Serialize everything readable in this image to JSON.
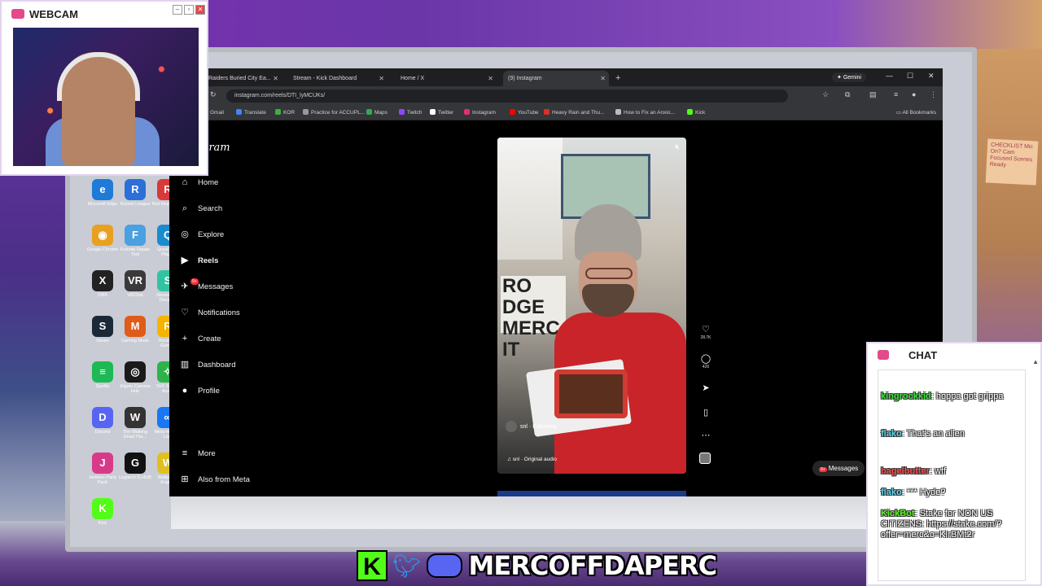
{
  "overlay": {
    "webcam_title": "WEBCAM",
    "chat_title": "CHAT",
    "checklist_note": "CHECKLIST Mic On? Cam Focused Scenes Ready",
    "handle": "MERCOFFDAPERC",
    "kick_letter": "K"
  },
  "browser": {
    "tabs": [
      {
        "label": "Raiders Buried City Ea..."
      },
      {
        "label": "Stream - Kick Dashboard"
      },
      {
        "label": "Home / X"
      },
      {
        "label": "(9) Instagram"
      }
    ],
    "gemini_label": "Gemini",
    "url": "instagram.com/reels/DTI_lyMCUKs/",
    "bookmarks": [
      {
        "label": "Gmail",
        "color": "#d93025"
      },
      {
        "label": "Translate",
        "color": "#4285f4"
      },
      {
        "label": "KOR",
        "color": "#3cb043"
      },
      {
        "label": "Practice for ACCUPL...",
        "color": "#999999"
      },
      {
        "label": "Maps",
        "color": "#34a853"
      },
      {
        "label": "Twitch",
        "color": "#9146ff"
      },
      {
        "label": "Twitter",
        "color": "#ffffff"
      },
      {
        "label": "Instagram",
        "color": "#e1306c"
      },
      {
        "label": "YouTube",
        "color": "#ff0000"
      },
      {
        "label": "Heavy Rain and Thu...",
        "color": "#d93025"
      },
      {
        "label": "How to Fix an Anxio...",
        "color": "#bbbbbb"
      },
      {
        "label": "Kick",
        "color": "#53fc18"
      }
    ],
    "all_bookmarks": "All Bookmarks"
  },
  "instagram": {
    "logo": "gram",
    "nav": [
      {
        "label": "Home",
        "icon": "home-icon",
        "glyph": "⌂"
      },
      {
        "label": "Search",
        "icon": "search-icon",
        "glyph": "⌕"
      },
      {
        "label": "Explore",
        "icon": "compass-icon",
        "glyph": "◎"
      },
      {
        "label": "Reels",
        "icon": "reels-icon",
        "glyph": "▶"
      },
      {
        "label": "Messages",
        "icon": "messages-icon",
        "glyph": "✈",
        "badge": "9+"
      },
      {
        "label": "Notifications",
        "icon": "heart-icon",
        "glyph": "♡"
      },
      {
        "label": "Create",
        "icon": "plus-icon",
        "glyph": "+"
      },
      {
        "label": "Dashboard",
        "icon": "dashboard-icon",
        "glyph": "▥"
      },
      {
        "label": "Profile",
        "icon": "avatar-icon",
        "glyph": "●"
      }
    ],
    "more": "More",
    "also_from_meta": "Also from Meta",
    "reel": {
      "username": "snl",
      "following": "Following",
      "audio": "snl · Original audio",
      "sign_text": "RO\nDGE\nMERC\nIT",
      "likes": "28.7K",
      "comments": "426"
    },
    "messages_pill": "Messages",
    "messages_badge": "9+"
  },
  "desktop_icons": [
    {
      "label": "Microsoft Edge",
      "color": "#1f7ad8",
      "glyph": "e"
    },
    {
      "label": "Rocket League",
      "color": "#2c6fd8",
      "glyph": "R"
    },
    {
      "label": "Riot Repair Tool",
      "color": "#d83a3a",
      "glyph": "R"
    },
    {
      "label": "Google Chrome",
      "color": "#e8a020",
      "glyph": "◉"
    },
    {
      "label": "Fortnite Repair Tool",
      "color": "#4aa0e0",
      "glyph": "F"
    },
    {
      "label": "QuickTime Player",
      "color": "#1b8bd0",
      "glyph": "Q"
    },
    {
      "label": "OBS",
      "color": "#222222",
      "glyph": "X"
    },
    {
      "label": "VRChat",
      "color": "#3a3a3a",
      "glyph": "VR"
    },
    {
      "label": "Streamlabs Desktop",
      "color": "#31c3a2",
      "glyph": "S"
    },
    {
      "label": "Steam",
      "color": "#1b2838",
      "glyph": "S"
    },
    {
      "label": "Gaming Mode",
      "color": "#e05a1a",
      "glyph": "M"
    },
    {
      "label": "Rockstar Games",
      "color": "#f4b400",
      "glyph": "R"
    },
    {
      "label": "Spotify",
      "color": "#1db954",
      "glyph": "≡"
    },
    {
      "label": "Elgato Camera Hub",
      "color": "#1a1a1a",
      "glyph": "◎"
    },
    {
      "label": "THX Spatial Audio",
      "color": "#2db34a",
      "glyph": "✧"
    },
    {
      "label": "Discord",
      "color": "#5865f2",
      "glyph": "D"
    },
    {
      "label": "The Walking Dead The...",
      "color": "#333333",
      "glyph": "W"
    },
    {
      "label": "Meta Horizon Link",
      "color": "#1877f2",
      "glyph": "∞"
    },
    {
      "label": "Jackbox Party Pack",
      "color": "#d83a8a",
      "glyph": "J"
    },
    {
      "label": "Logitech G HUB",
      "color": "#111111",
      "glyph": "G"
    },
    {
      "label": "Wallpaper Engine",
      "color": "#e0c020",
      "glyph": "W"
    },
    {
      "label": "Kick",
      "color": "#53fc18",
      "glyph": "K"
    }
  ],
  "chat": {
    "messages": [
      {
        "user": "kingrockkid",
        "text": "hoppa got grippa",
        "color": "#3de03d"
      },
      {
        "user": "flako",
        "text": "That's an alien",
        "color": "#5fd0e8"
      },
      {
        "user": "bagelbutter",
        "text": "wtf",
        "color": "#ff4a4a"
      },
      {
        "user": "flako",
        "text": "*** Hyde?",
        "color": "#5fd0e8"
      },
      {
        "user": "KickBot",
        "text": "Stake for NON US CITIZENS: https://stake.com/?offer=merc&c=KIrBMt2r",
        "color": "#53fc18"
      }
    ]
  }
}
